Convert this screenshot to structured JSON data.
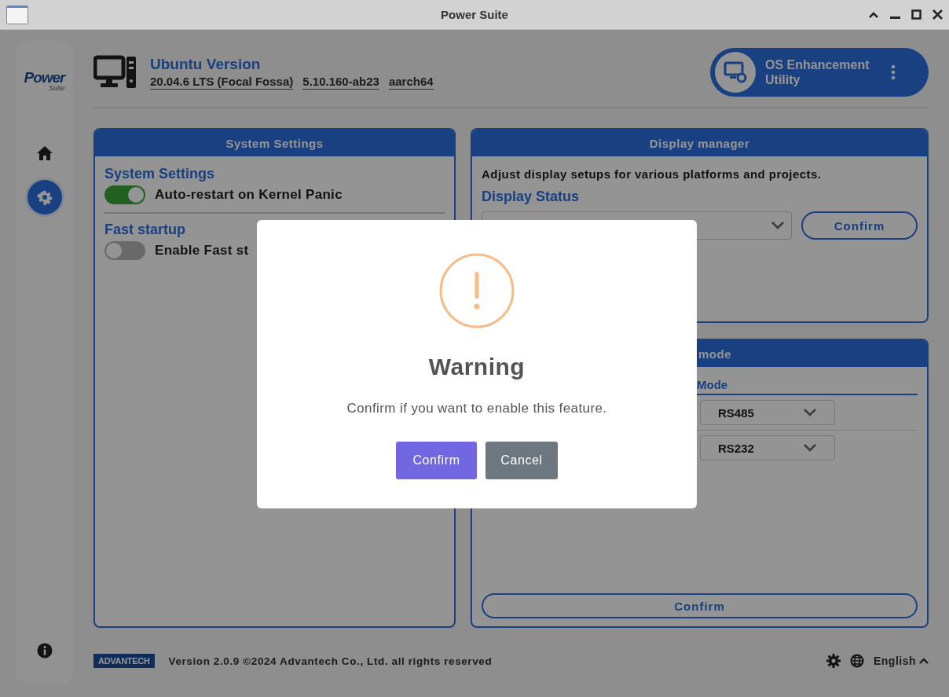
{
  "window": {
    "title": "Power Suite"
  },
  "sidebar": {
    "logo": {
      "title": "Power",
      "subtitle": "Suite"
    },
    "items": [
      {
        "kind": "home",
        "selected": false
      },
      {
        "kind": "settings",
        "selected": true
      },
      {
        "kind": "info",
        "selected": false
      }
    ]
  },
  "header": {
    "title": "Ubuntu Version",
    "versions": [
      "20.04.6 LTS (Focal Fossa)",
      "5.10.160-ab23",
      "aarch64"
    ],
    "utility": {
      "label": "OS Enhancement Utility"
    }
  },
  "system_panel": {
    "title": "System Settings",
    "sections": [
      {
        "heading": "System Settings",
        "toggles": [
          {
            "label": "Auto-restart on Kernel Panic",
            "on": true
          }
        ]
      },
      {
        "heading": "Fast startup",
        "toggles": [
          {
            "label": "Enable Fast st",
            "on": false
          }
        ]
      }
    ]
  },
  "display_panel": {
    "title": "Display manager",
    "description": "Adjust display setups for various platforms and projects.",
    "status_heading": "Display Status",
    "confirm_button": "Confirm"
  },
  "serial_panel": {
    "title": "mode",
    "subheading": "Mode",
    "rows": [
      {
        "value": "RS485"
      },
      {
        "value": "RS232"
      }
    ],
    "confirm_button": "Confirm"
  },
  "footer": {
    "brand": "ADVANTECH",
    "copyright": "Version 2.0.9 ©2024 Advantech Co., Ltd. all rights reserved",
    "language": "English"
  },
  "dialog": {
    "title": "Warning",
    "message": "Confirm if you want to enable this feature.",
    "buttons": [
      {
        "label": "Confirm",
        "kind": "primary"
      },
      {
        "label": "Cancel",
        "kind": "secondary"
      }
    ]
  }
}
